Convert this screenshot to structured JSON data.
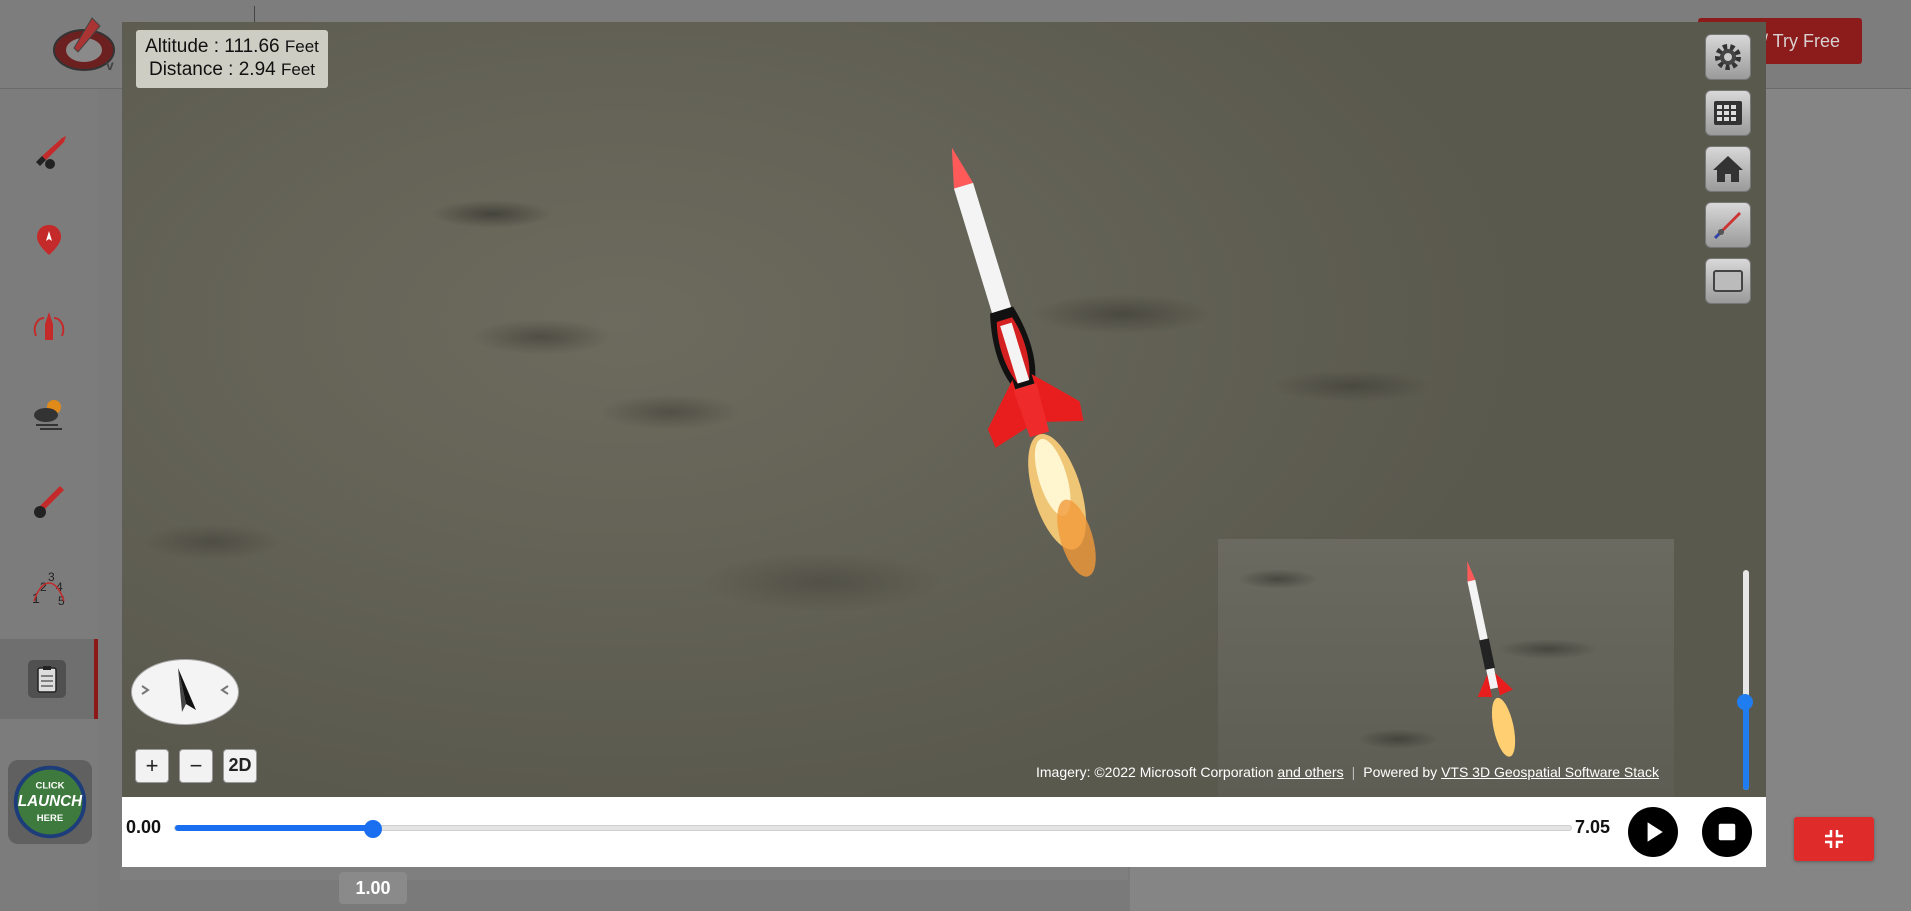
{
  "header": {
    "try_free_label": "/ Try Free"
  },
  "sidebar": {
    "items": [
      {
        "icon": "rocket-select-icon"
      },
      {
        "icon": "launch-site-pin-icon"
      },
      {
        "icon": "rocket-recovery-icon"
      },
      {
        "icon": "weather-icon"
      },
      {
        "icon": "rocket-tool-icon"
      },
      {
        "icon": "sequence-numbers-icon"
      },
      {
        "icon": "clipboard-report-icon"
      }
    ],
    "launch_button": {
      "line1": "CLICK",
      "line2": "LAUNCH",
      "line3": "HERE"
    }
  },
  "viewer": {
    "readout": {
      "altitude_label": "Altitude : ",
      "altitude_value": "111.66",
      "altitude_unit": "Feet",
      "distance_label": "Distance : ",
      "distance_value": "2.94",
      "distance_unit": "Feet"
    },
    "tools": [
      "settings-gear-icon",
      "calculator-grid-icon",
      "home-icon",
      "rocket-view-icon",
      "window-toggle-icon"
    ],
    "zoom": {
      "plus": "+",
      "minus": "−",
      "mode": "2D"
    },
    "attribution": {
      "imagery_prefix": "Imagery: ©2022 Microsoft Corporation ",
      "imagery_link": "and others",
      "powered_prefix": "Powered by ",
      "powered_link": "VTS 3D Geospatial Software Stack"
    },
    "camera_slider_level": 0.4
  },
  "timeline": {
    "start": "0.00",
    "end": "7.05",
    "current": "1.00",
    "current_value": 1.0,
    "max_value": 7.05
  },
  "colors": {
    "accent": "#1a6ff0",
    "brand_red": "#e02b2b"
  }
}
